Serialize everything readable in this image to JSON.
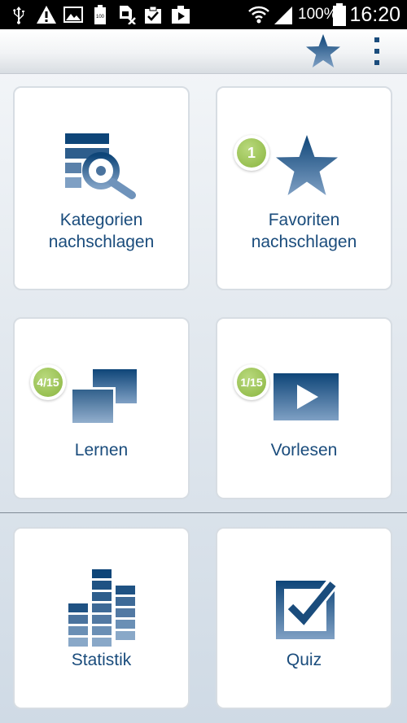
{
  "status_bar": {
    "battery_percent": "100%",
    "time": "16:20",
    "icons": [
      "usb-icon",
      "warning-icon",
      "image-icon",
      "battery-full-icon",
      "sim-off-icon",
      "clipboard-check-icon",
      "video-play-icon",
      "wifi-icon",
      "signal-icon",
      "battery-icon"
    ]
  },
  "action_bar": {
    "icons": [
      "star-icon",
      "overflow-menu-icon"
    ]
  },
  "tiles": [
    {
      "id": "kategorien",
      "label_line1": "Kategorien",
      "label_line2": "nachschlagen",
      "icon": "category-search-icon",
      "badge": ""
    },
    {
      "id": "favoriten",
      "label_line1": "Favoriten",
      "label_line2": "nachschlagen",
      "icon": "star-icon",
      "badge": "1"
    },
    {
      "id": "lernen",
      "label_line1": "Lernen",
      "label_line2": "",
      "icon": "cards-icon",
      "badge": "4/15"
    },
    {
      "id": "vorlesen",
      "label_line1": "Vorlesen",
      "label_line2": "",
      "icon": "play-icon",
      "badge": "1/15"
    },
    {
      "id": "statistik",
      "label_line1": "Statistik",
      "label_line2": "",
      "icon": "bar-stats-icon",
      "badge": ""
    },
    {
      "id": "quiz",
      "label_line1": "Quiz",
      "label_line2": "",
      "icon": "checkbox-icon",
      "badge": ""
    }
  ],
  "colors": {
    "icon_dark": "#0e4578",
    "icon_light": "#6a8fb5",
    "label": "#1a4c7c",
    "badge_green": "#98c052"
  }
}
